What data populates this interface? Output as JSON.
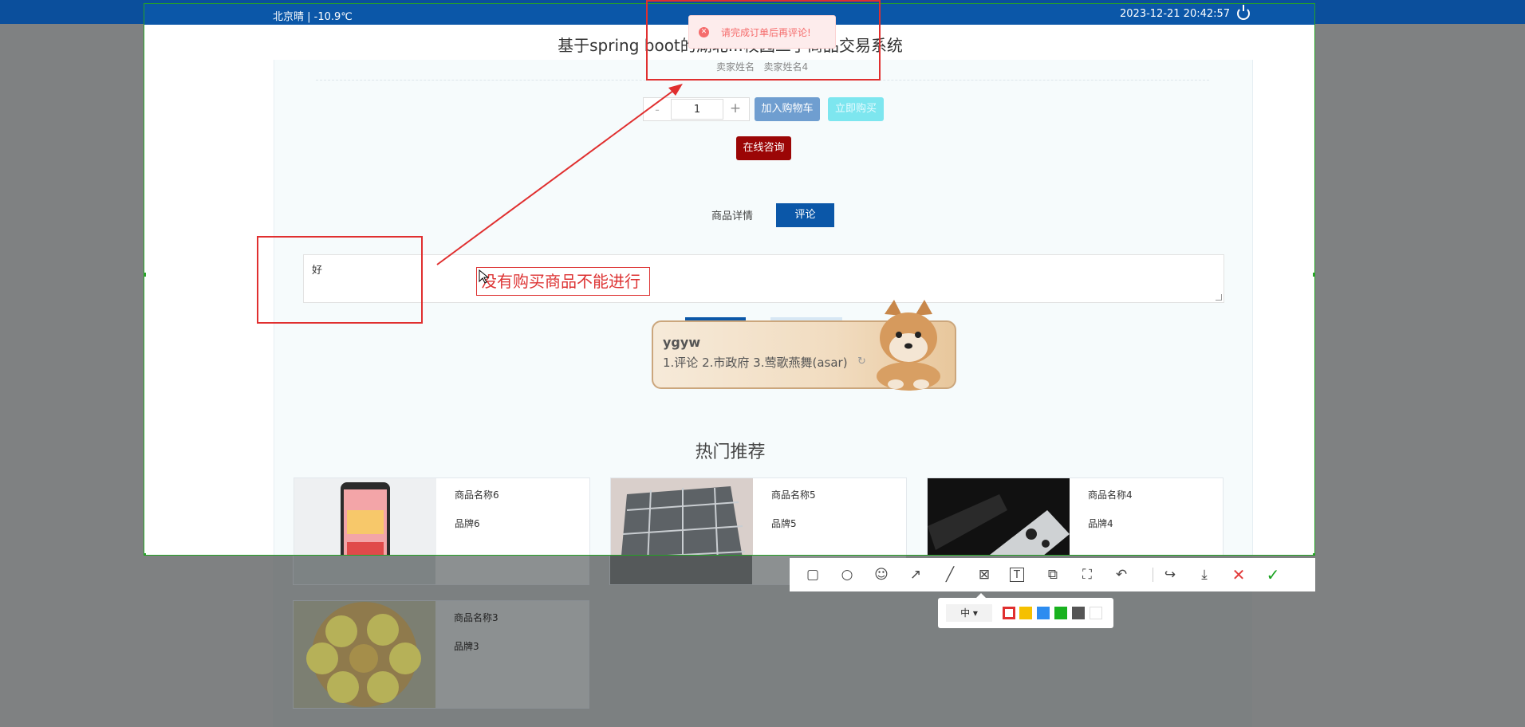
{
  "topbar": {
    "weather": "北京晴 | -10.9℃",
    "datetime": "2023-12-21   20:42:57",
    "power_icon": "power-icon"
  },
  "site": {
    "title": "基于spring boot的湖北...校园二手商品交易系统"
  },
  "product": {
    "seller_label": "卖家姓名",
    "seller_value": "卖家姓名4",
    "quantity": "1",
    "minus": "-",
    "plus": "+",
    "add_to_cart": "加入购物车",
    "buy_now": "立即购买",
    "online_chat": "在线咨询"
  },
  "tabs": {
    "detail": "商品详情",
    "review": "评论"
  },
  "review": {
    "textarea_value": "好"
  },
  "annotation": {
    "text": "没有购买商品不能进行"
  },
  "toast": {
    "message": "请完成订单后再评论!",
    "icon": "error-icon"
  },
  "ime": {
    "typed": "ygyw",
    "candidates": "1.评论  2.市政府  3.莺歌燕舞(asar)"
  },
  "hot": {
    "title": "热门推荐",
    "items": [
      {
        "name": "商品名称6",
        "brand": "品牌6"
      },
      {
        "name": "商品名称5",
        "brand": "品牌5"
      },
      {
        "name": "商品名称4",
        "brand": "品牌4"
      },
      {
        "name": "商品名称3",
        "brand": "品牌3"
      }
    ]
  },
  "toolbar": {
    "tools": [
      "rectangle-icon",
      "circle-icon",
      "emoji-icon",
      "arrow-icon",
      "line-icon",
      "mosaic-icon",
      "text-icon",
      "pin-icon",
      "ocr-icon",
      "undo-icon",
      "share-icon",
      "download-icon",
      "close-icon",
      "confirm-icon"
    ],
    "size_label": "中"
  },
  "colors": {
    "brand_blue": "#0b57a8",
    "annotation_red": "#e02f2f",
    "palette": [
      "#e02f2f",
      "#f5c000",
      "#2d8cf0",
      "#19b21f",
      "#555555",
      "#ffffff"
    ]
  }
}
